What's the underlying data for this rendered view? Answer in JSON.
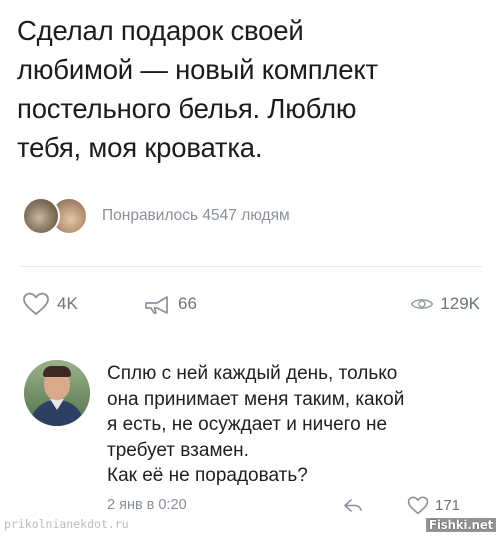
{
  "post": {
    "text_lines": [
      "Сделал подарок своей",
      "любимой — новый комплект",
      "постельного белья. Люблю",
      "тебя, моя кроватка."
    ],
    "likes_summary": "Понравилось 4547 людям",
    "actions": {
      "likes": "4K",
      "shares": "66",
      "views": "129K"
    }
  },
  "comment": {
    "text_lines": [
      "Сплю с ней каждый день, только",
      "она принимает меня таким, какой",
      "я есть, не осуждает и ничего не",
      "требует взамен.",
      "Как её не порадовать?"
    ],
    "date": "2 янв в 0:20",
    "likes": "171"
  },
  "watermarks": {
    "left": "prikolnianekdot.ru",
    "right": "Fishki.net"
  },
  "icons": {
    "like": "heart-icon",
    "share": "megaphone-icon",
    "views": "eye-icon",
    "reply": "reply-arrow-icon"
  },
  "colors": {
    "text": "#1c1c1c",
    "muted": "#8a8f99",
    "divider": "#e6e8ec"
  }
}
